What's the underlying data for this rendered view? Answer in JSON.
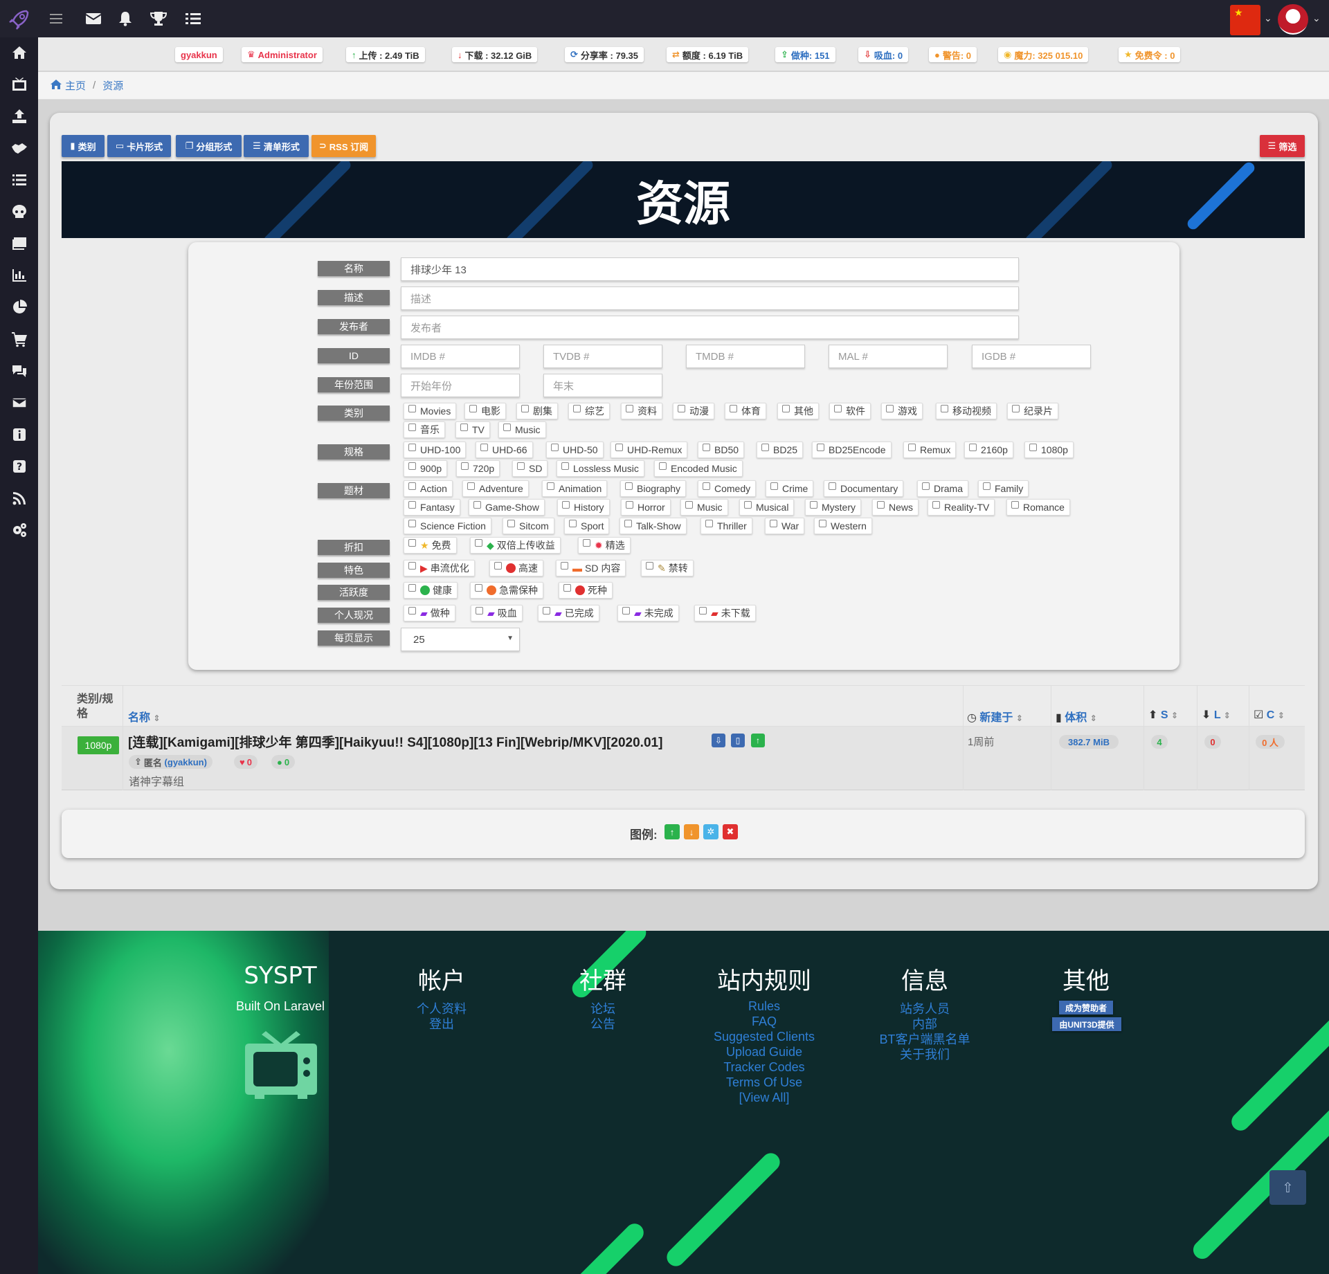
{
  "stats": {
    "username": "gyakkun",
    "role": "Administrator",
    "upload": "上传 : 2.49 TiB",
    "download": "下载 : 32.12 GiB",
    "ratio": "分享率 : 79.35",
    "buffer": "额度 : 6.19 TiB",
    "seeding": "做种: 151",
    "leeching": "吸血: 0",
    "warnings": "警告: 0",
    "bonus": "魔力: 325 015.10",
    "freeleech_tokens": "免费令 : 0"
  },
  "breadcrumb": {
    "home": "主页",
    "separator": "/",
    "current": "资源"
  },
  "toolbar": {
    "category": "类别",
    "card_view": "卡片形式",
    "group_view": "分组形式",
    "list_view": "清单形式",
    "rss": "RSS 订阅",
    "filter": "筛选"
  },
  "banner_title": "资源",
  "form": {
    "labels": {
      "name": "名称",
      "description": "描述",
      "uploader": "发布者",
      "id": "ID",
      "year_range": "年份范围",
      "category": "类别",
      "resolution": "规格",
      "genre": "题材",
      "discount": "折扣",
      "special": "特色",
      "health": "活跃度",
      "personal": "个人现况",
      "per_page": "每页显示"
    },
    "name_value": "排球少年 13",
    "description_placeholder": "描述",
    "uploader_placeholder": "发布者",
    "id_placeholders": [
      "IMDB #",
      "TVDB #",
      "TMDB #",
      "MAL #",
      "IGDB #"
    ],
    "year_start_placeholder": "开始年份",
    "year_end_placeholder": "年末",
    "categories": [
      "Movies",
      "电影",
      "剧集",
      "综艺",
      "资料",
      "动漫",
      "体育",
      "其他",
      "软件",
      "游戏",
      "移动视频",
      "纪录片",
      "音乐",
      "TV",
      "Music"
    ],
    "resolutions": [
      "UHD-100",
      "UHD-66",
      "UHD-50",
      "UHD-Remux",
      "BD50",
      "BD25",
      "BD25Encode",
      "Remux",
      "2160p",
      "1080p",
      "900p",
      "720p",
      "SD",
      "Lossless Music",
      "Encoded Music"
    ],
    "genres": [
      "Action",
      "Adventure",
      "Animation",
      "Biography",
      "Comedy",
      "Crime",
      "Documentary",
      "Drama",
      "Family",
      "Fantasy",
      "Game-Show",
      "History",
      "Horror",
      "Music",
      "Musical",
      "Mystery",
      "News",
      "Reality-TV",
      "Romance",
      "Science Fiction",
      "Sitcom",
      "Sport",
      "Talk-Show",
      "Thriller",
      "War",
      "Western"
    ],
    "discounts": [
      "免费",
      "双倍上传收益",
      "精选"
    ],
    "specials": [
      "串流优化",
      "高速",
      "SD 内容",
      "禁转"
    ],
    "health": [
      "健康",
      "急需保种",
      "死种"
    ],
    "personal": [
      "做种",
      "吸血",
      "已完成",
      "未完成",
      "未下载"
    ],
    "per_page": "25"
  },
  "table": {
    "headers": {
      "category_res": "类别/规格",
      "name": "名称",
      "created": "新建于",
      "size": "体积",
      "seeders": "S",
      "leechers": "L",
      "completed": "C"
    },
    "rows": [
      {
        "resolution": "1080p",
        "name": "[连载][Kamigami][排球少年 第四季][Haikyuu!! S4][1080p][13 Fin][Webrip/MKV][2020.01]",
        "uploader": "匿名",
        "uploader_user": "(gyakkun)",
        "likes": "0",
        "comments": "0",
        "group": "诸神字幕组",
        "age": "1周前",
        "size": "382.7 MiB",
        "seeders": "4",
        "leechers": "0",
        "completed": "0 人"
      }
    ]
  },
  "legend": {
    "label": "图例:"
  },
  "footer": {
    "brand": {
      "title": "SYSPT",
      "subtitle": "Built On Laravel"
    },
    "account": {
      "title": "帐户",
      "links": [
        "个人资料",
        "登出"
      ]
    },
    "community": {
      "title": "社群",
      "links": [
        "论坛",
        "公告"
      ]
    },
    "rules": {
      "title": "站内规则",
      "links": [
        "Rules",
        "FAQ",
        "Suggested Clients",
        "Upload Guide",
        "Tracker Codes",
        "Terms Of Use",
        "[View All]"
      ]
    },
    "info": {
      "title": "信息",
      "links": [
        "站务人员",
        "内部",
        "BT客户端黑名单",
        "关于我们"
      ]
    },
    "other": {
      "title": "其他",
      "badges": [
        "成为赞助者",
        "由UNIT3D提供"
      ]
    }
  },
  "colors": {
    "topbar": "#22222e",
    "sidebar": "#1d1d29",
    "primary_button": "#3d6ab1",
    "rss_button": "#f0942c",
    "filter_button": "#d9303b",
    "link": "#2e6fc0",
    "footer_green": "#16d06a"
  }
}
